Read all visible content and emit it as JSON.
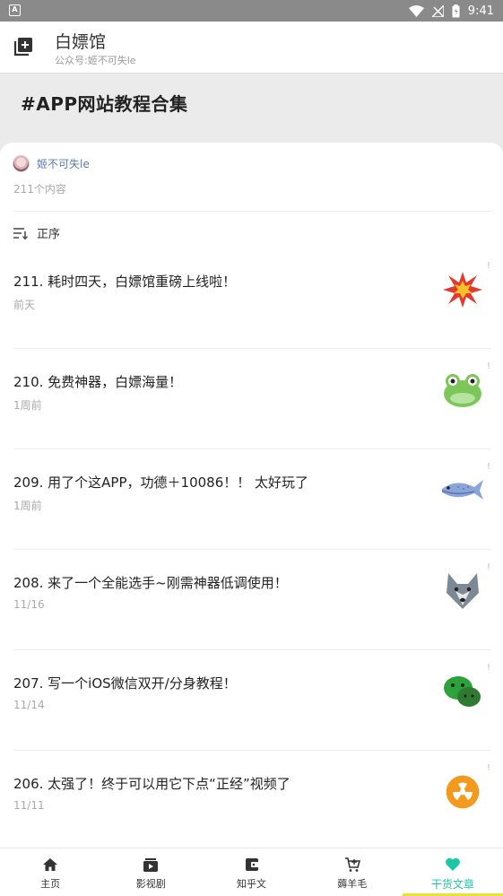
{
  "status_bar": {
    "app_letter": "A",
    "time": "9:41"
  },
  "app_bar": {
    "title": "白嫖馆",
    "subtitle": "公众号:姬不可失le"
  },
  "banner": {
    "heading": "#APP网站教程合集"
  },
  "author": {
    "name": "姬不可失le",
    "count": "211个内容"
  },
  "sort": {
    "label": "正序"
  },
  "articles": [
    {
      "title": "211. 耗时四天，白嫖馆重磅上线啦！",
      "date": "前天",
      "icon": "explosion-icon"
    },
    {
      "title": "210. 免费神器，白嫖海量！",
      "date": "1周前",
      "icon": "frog-icon"
    },
    {
      "title": "209. 用了个这APP，功德＋10086！！ 太好玩了",
      "date": "1周前",
      "icon": "fish-icon"
    },
    {
      "title": "208. 来了一个全能选手~刚需神器低调使用！",
      "date": "11/16",
      "icon": "wolf-icon"
    },
    {
      "title": "207. 写一个iOS微信双开/分身教程！",
      "date": "11/14",
      "icon": "wechat-icon"
    },
    {
      "title": "206. 太强了！终于可以用它下点“正经”视频了",
      "date": "11/11",
      "icon": "radioactive-icon"
    }
  ],
  "tabs": [
    {
      "label": "主页",
      "icon": "home-icon"
    },
    {
      "label": "影视剧",
      "icon": "video-icon"
    },
    {
      "label": "知乎文",
      "icon": "wallet-icon"
    },
    {
      "label": "薅羊毛",
      "icon": "cart-icon"
    },
    {
      "label": "干货文章",
      "icon": "heart-icon",
      "active": true
    }
  ],
  "colors": {
    "accent": "#1cc7a6",
    "tab_indicator": "#e8e23a",
    "author_link": "#5b7bb0"
  }
}
